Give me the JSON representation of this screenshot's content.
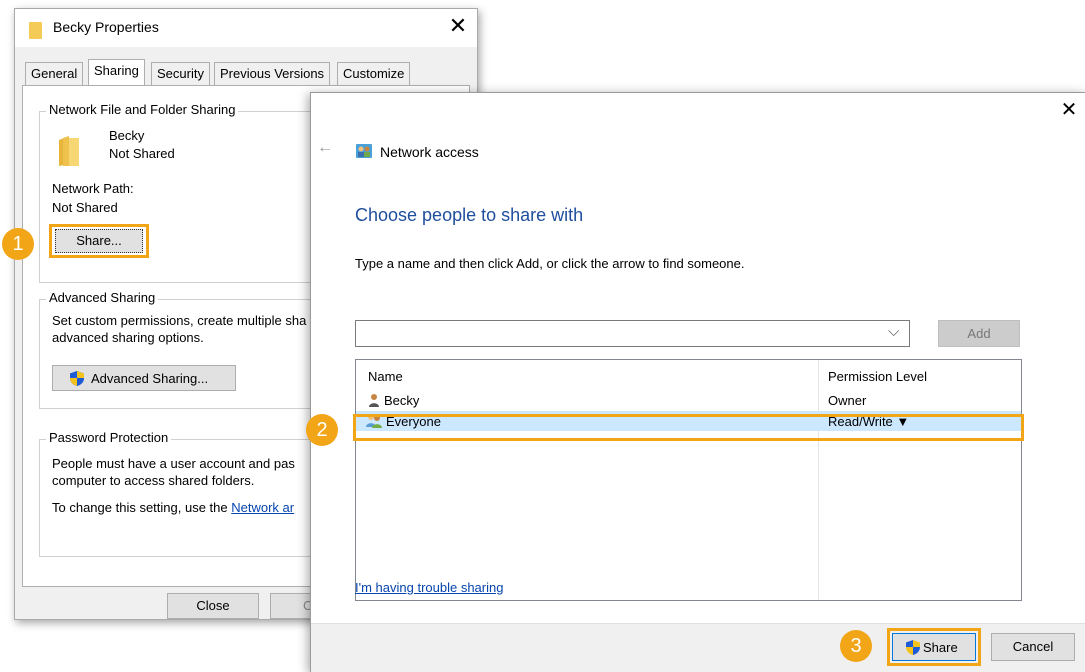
{
  "properties_dialog": {
    "title": "Becky Properties",
    "close_glyph": "✕",
    "tabs": [
      "General",
      "Sharing",
      "Security",
      "Previous Versions",
      "Customize"
    ],
    "active_tab": "Sharing",
    "network_sharing": {
      "group_title": "Network File and Folder Sharing",
      "folder_name": "Becky",
      "status": "Not Shared",
      "path_label": "Network Path:",
      "path_value": "Not Shared",
      "share_button": "Share..."
    },
    "advanced_sharing": {
      "group_title": "Advanced Sharing",
      "description_line1": "Set custom permissions, create multiple sha",
      "description_line2": "advanced sharing options.",
      "button_label": "Advanced Sharing..."
    },
    "password_protection": {
      "group_title": "Password Protection",
      "text_line1": "People must have a user account and pas",
      "text_line2": "computer to access shared folders.",
      "text_line3_prefix": "To change this setting, use the ",
      "text_line3_link": "Network ar"
    },
    "buttons": {
      "close": "Close",
      "cancel_partial": "Ca"
    }
  },
  "network_access_dialog": {
    "close_glyph": "✕",
    "back_glyph": "←",
    "title": "Network access",
    "heading": "Choose people to share with",
    "instruction": "Type a name and then click Add, or click the arrow to find someone.",
    "name_input_value": "",
    "dropdown_glyph": "⌵",
    "add_button": "Add",
    "columns": [
      "Name",
      "Permission Level"
    ],
    "rows": [
      {
        "name": "Becky",
        "permission": "Owner"
      },
      {
        "name": "Everyone",
        "permission": "Read/Write ▼"
      }
    ],
    "trouble_link": "I'm having trouble sharing",
    "share_button": "Share",
    "cancel_button": "Cancel"
  },
  "step_badges": [
    "1",
    "2",
    "3"
  ],
  "colors": {
    "highlight": "#f2a516",
    "heading_blue": "#1e4e9c",
    "selected_row": "#cce8ff",
    "link_blue": "#0645ad"
  }
}
